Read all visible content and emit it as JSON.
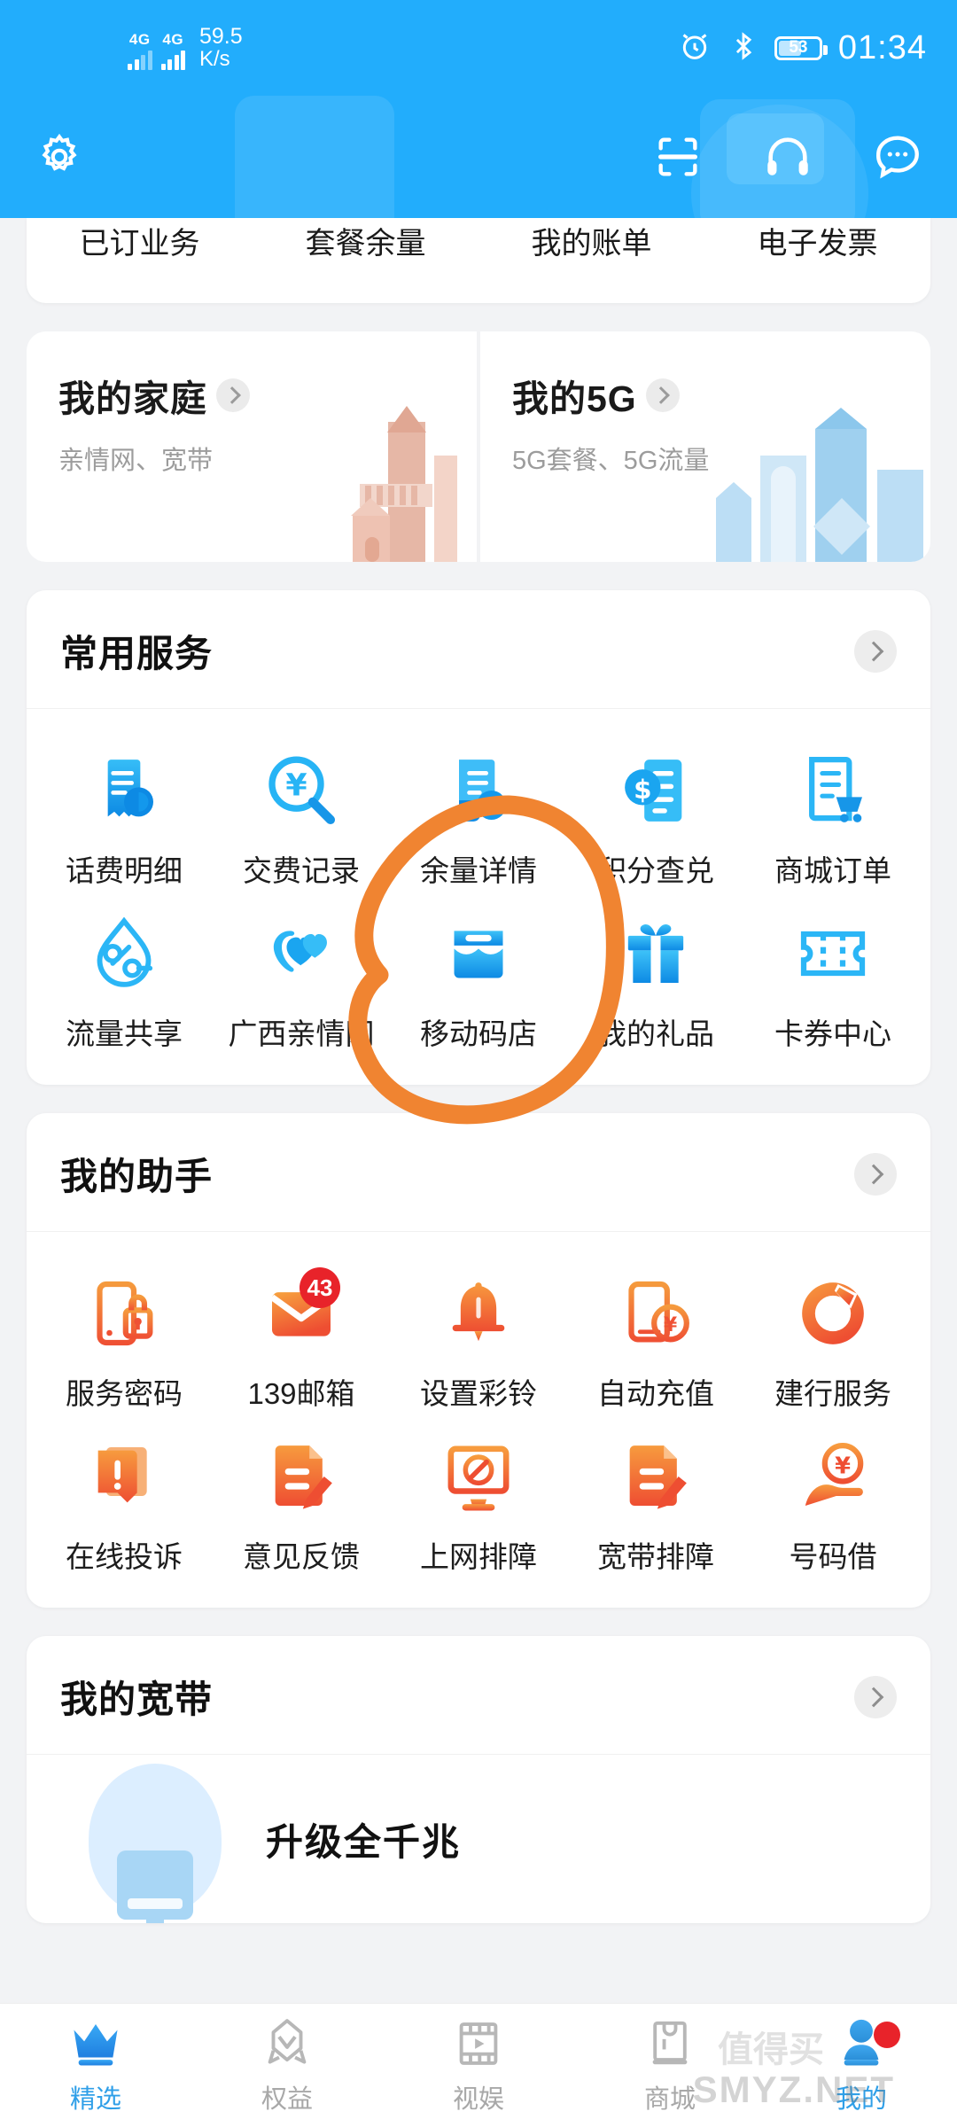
{
  "status_bar": {
    "network_1": "4G",
    "network_2": "4G",
    "net_speed_value": "59.5",
    "net_speed_unit": "K/s",
    "alarm_icon": "alarm-icon",
    "bluetooth_icon": "bluetooth-icon",
    "battery_percent": "53",
    "time": "01:34"
  },
  "top_bar": {
    "settings_icon": "gear-icon",
    "scan_icon": "scan-icon",
    "service_icon": "headphone-icon",
    "message_icon": "chat-bubble-icon"
  },
  "quick_links": [
    {
      "label": "已订业务"
    },
    {
      "label": "套餐余量"
    },
    {
      "label": "我的账单"
    },
    {
      "label": "电子发票"
    }
  ],
  "feature_cards": [
    {
      "title": "我的家庭",
      "subtitle": "亲情网、宽带",
      "art": "house-illustration"
    },
    {
      "title": "我的5G",
      "subtitle": "5G套餐、5G流量",
      "art": "city-illustration"
    }
  ],
  "common_services": {
    "title": "常用服务",
    "more_icon": "chevron-right-icon",
    "items": [
      {
        "label": "话费明细",
        "icon": "bill-detail-icon"
      },
      {
        "label": "交费记录",
        "icon": "payment-record-icon"
      },
      {
        "label": "余量详情",
        "icon": "balance-detail-icon"
      },
      {
        "label": "积分查兑",
        "icon": "points-exchange-icon"
      },
      {
        "label": "商城订单",
        "icon": "mall-order-icon"
      },
      {
        "label": "流量共享",
        "icon": "data-share-icon"
      },
      {
        "label": "广西亲情网",
        "icon": "family-net-icon"
      },
      {
        "label": "移动码店",
        "icon": "code-shop-icon"
      },
      {
        "label": "我的礼品",
        "icon": "gift-icon"
      },
      {
        "label": "卡券中心",
        "icon": "coupon-icon"
      }
    ]
  },
  "my_assistant": {
    "title": "我的助手",
    "more_icon": "chevron-right-icon",
    "items": [
      {
        "label": "服务密码",
        "icon": "phone-lock-icon",
        "badge": ""
      },
      {
        "label": "139邮箱",
        "icon": "mail-icon",
        "badge": "43"
      },
      {
        "label": "设置彩铃",
        "icon": "bell-icon",
        "badge": ""
      },
      {
        "label": "自动充值",
        "icon": "auto-recharge-icon",
        "badge": ""
      },
      {
        "label": "建行服务",
        "icon": "ccb-bank-icon",
        "badge": ""
      },
      {
        "label": "在线投诉",
        "icon": "complaint-icon",
        "badge": ""
      },
      {
        "label": "意见反馈",
        "icon": "feedback-icon",
        "badge": ""
      },
      {
        "label": "上网排障",
        "icon": "network-troubleshoot-icon",
        "badge": ""
      },
      {
        "label": "宽带排障",
        "icon": "broadband-troubleshoot-icon",
        "badge": ""
      },
      {
        "label": "号码借",
        "icon": "number-loan-icon",
        "badge": ""
      }
    ]
  },
  "my_broadband": {
    "title": "我的宽带",
    "more_icon": "chevron-right-icon",
    "promo_text": "升级全千兆",
    "promo_icon": "monitor-illustration"
  },
  "bottom_nav": [
    {
      "label": "精选",
      "icon": "crown-icon",
      "active": true,
      "dot": false
    },
    {
      "label": "权益",
      "icon": "rocket-icon",
      "active": false,
      "dot": false
    },
    {
      "label": "视娱",
      "icon": "film-icon",
      "active": false,
      "dot": false
    },
    {
      "label": "商城",
      "icon": "shopping-bag-icon",
      "active": false,
      "dot": false
    },
    {
      "label": "我的",
      "icon": "person-icon",
      "active": true,
      "dot": true
    }
  ],
  "annotation": {
    "shape": "hand-drawn-circle",
    "color": "#f08431",
    "targets": "我的礼品"
  },
  "watermark": {
    "site": "SMYZ.NET",
    "text": "值得买"
  },
  "colors": {
    "header_blue": "#22adfc",
    "page_bg": "#f2f3f5",
    "accent_blue": "#1296db",
    "accent_orange": "#f2682a",
    "badge_red": "#e8232a",
    "annotation_orange": "#f08431"
  }
}
